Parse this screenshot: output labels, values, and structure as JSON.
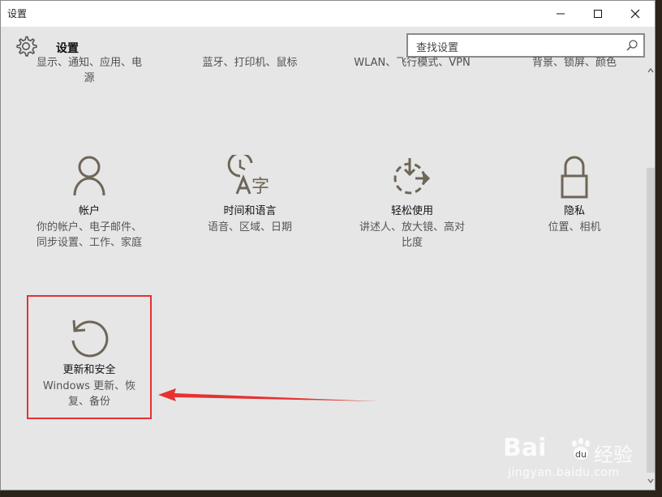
{
  "window": {
    "title": "设置"
  },
  "header": {
    "title": "设置",
    "search_placeholder": "查找设置"
  },
  "partial_row": [
    {
      "line1": "显示、通知、应用、电",
      "line2": "源"
    },
    {
      "line1": "蓝牙、打印机、鼠标",
      "line2": ""
    },
    {
      "line1": "WLAN、飞行模式、VPN",
      "line2": ""
    },
    {
      "line1": "背景、锁屏、颜色",
      "line2": ""
    }
  ],
  "tiles": [
    {
      "label": "帐户",
      "desc1": "你的帐户、电子邮件、",
      "desc2": "同步设置、工作、家庭",
      "icon": "person-icon"
    },
    {
      "label": "时间和语言",
      "desc1": "语音、区域、日期",
      "desc2": "",
      "icon": "time-language-icon"
    },
    {
      "label": "轻松使用",
      "desc1": "讲述人、放大镜、高对",
      "desc2": "比度",
      "icon": "ease-of-access-icon"
    },
    {
      "label": "隐私",
      "desc1": "位置、相机",
      "desc2": "",
      "icon": "lock-icon"
    },
    {
      "label": "更新和安全",
      "desc1": "Windows 更新、恢",
      "desc2": "复、备份",
      "icon": "update-icon"
    }
  ],
  "watermark": {
    "brand": "Bai",
    "brand_tail": "经验",
    "url": "jingyan.baidu.com"
  },
  "colors": {
    "icon": "#6e6658",
    "highlight": "#e53232",
    "window_bg": "#e6e6e6"
  }
}
